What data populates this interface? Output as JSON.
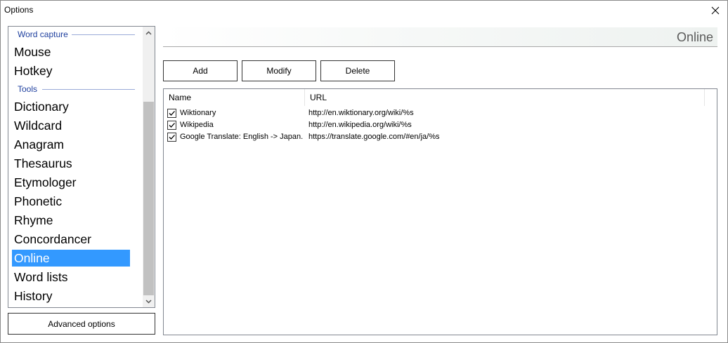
{
  "window": {
    "title": "Options"
  },
  "sidebar": {
    "groups": [
      {
        "label": "Word capture"
      },
      {
        "label": "Tools"
      }
    ],
    "items": [
      {
        "label": "Mouse"
      },
      {
        "label": "Hotkey"
      },
      {
        "label": "Dictionary"
      },
      {
        "label": "Wildcard"
      },
      {
        "label": "Anagram"
      },
      {
        "label": "Thesaurus"
      },
      {
        "label": "Etymologer"
      },
      {
        "label": "Phonetic"
      },
      {
        "label": "Rhyme"
      },
      {
        "label": "Concordancer"
      },
      {
        "label": "Online"
      },
      {
        "label": "Word lists"
      },
      {
        "label": "History"
      }
    ],
    "selected_item": "Online",
    "advanced_button_label": "Advanced options"
  },
  "main": {
    "section_title": "Online",
    "toolbar": {
      "add_label": "Add",
      "modify_label": "Modify",
      "delete_label": "Delete"
    },
    "table": {
      "columns": [
        "Name",
        "URL"
      ],
      "rows": [
        {
          "checked": true,
          "name": "Wiktionary",
          "url": "http://en.wiktionary.org/wiki/%s"
        },
        {
          "checked": true,
          "name": "Wikipedia",
          "url": "http://en.wikipedia.org/wiki/%s"
        },
        {
          "checked": true,
          "name": "Google Translate: English -> Japan...",
          "url": "https://translate.google.com/#en/ja/%s"
        }
      ]
    }
  },
  "icons": {
    "close": "close-icon",
    "scroll_up": "chevron-up-icon",
    "scroll_down": "chevron-down-icon",
    "checkbox": "checkmark-icon"
  },
  "colors": {
    "selection": "#3399ff",
    "group_header": "#1e3f9e",
    "section_title": "#5a5a5a"
  }
}
